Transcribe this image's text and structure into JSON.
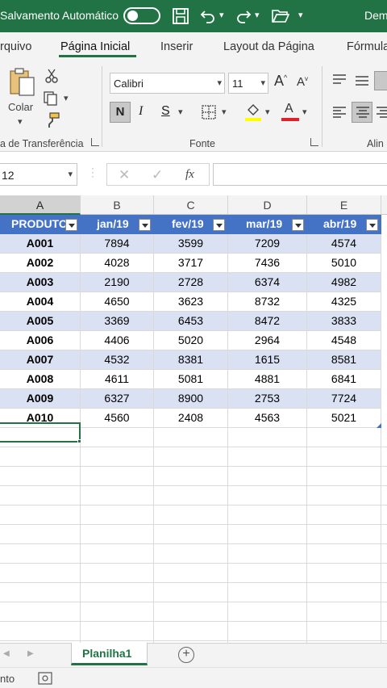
{
  "titlebar": {
    "autosave_label": "Salvamento Automático",
    "doc_name": "Dem"
  },
  "tabs": [
    "rquivo",
    "Página Inicial",
    "Inserir",
    "Layout da Página",
    "Fórmula"
  ],
  "ribbon": {
    "paste_label": "Colar",
    "clipboard_group": "a de Transferência",
    "font_name": "Calibri",
    "font_size": "11",
    "bold": "N",
    "italic": "I",
    "underline": "S",
    "font_group": "Fonte",
    "align_group": "Alin"
  },
  "formula_bar": {
    "name_box": "12",
    "fx": "fx",
    "value": ""
  },
  "columns": [
    "A",
    "B",
    "C",
    "D",
    "E"
  ],
  "table": {
    "headers": [
      "PRODUTO",
      "jan/19",
      "fev/19",
      "mar/19",
      "abr/19"
    ],
    "rows": [
      [
        "A001",
        "7894",
        "3599",
        "7209",
        "4574"
      ],
      [
        "A002",
        "4028",
        "3717",
        "7436",
        "5010"
      ],
      [
        "A003",
        "2190",
        "2728",
        "6374",
        "4982"
      ],
      [
        "A004",
        "4650",
        "3623",
        "8732",
        "4325"
      ],
      [
        "A005",
        "3369",
        "6453",
        "8472",
        "3833"
      ],
      [
        "A006",
        "4406",
        "5020",
        "2964",
        "4548"
      ],
      [
        "A007",
        "4532",
        "8381",
        "1615",
        "8581"
      ],
      [
        "A008",
        "4611",
        "5081",
        "4881",
        "6841"
      ],
      [
        "A009",
        "6327",
        "8900",
        "2753",
        "7724"
      ],
      [
        "A010",
        "4560",
        "2408",
        "4563",
        "5021"
      ]
    ]
  },
  "sheet_tab": "Planilha1",
  "status": "nto",
  "colors": {
    "excel_green": "#217346",
    "table_header": "#4472c4",
    "band": "#d9e1f2"
  }
}
